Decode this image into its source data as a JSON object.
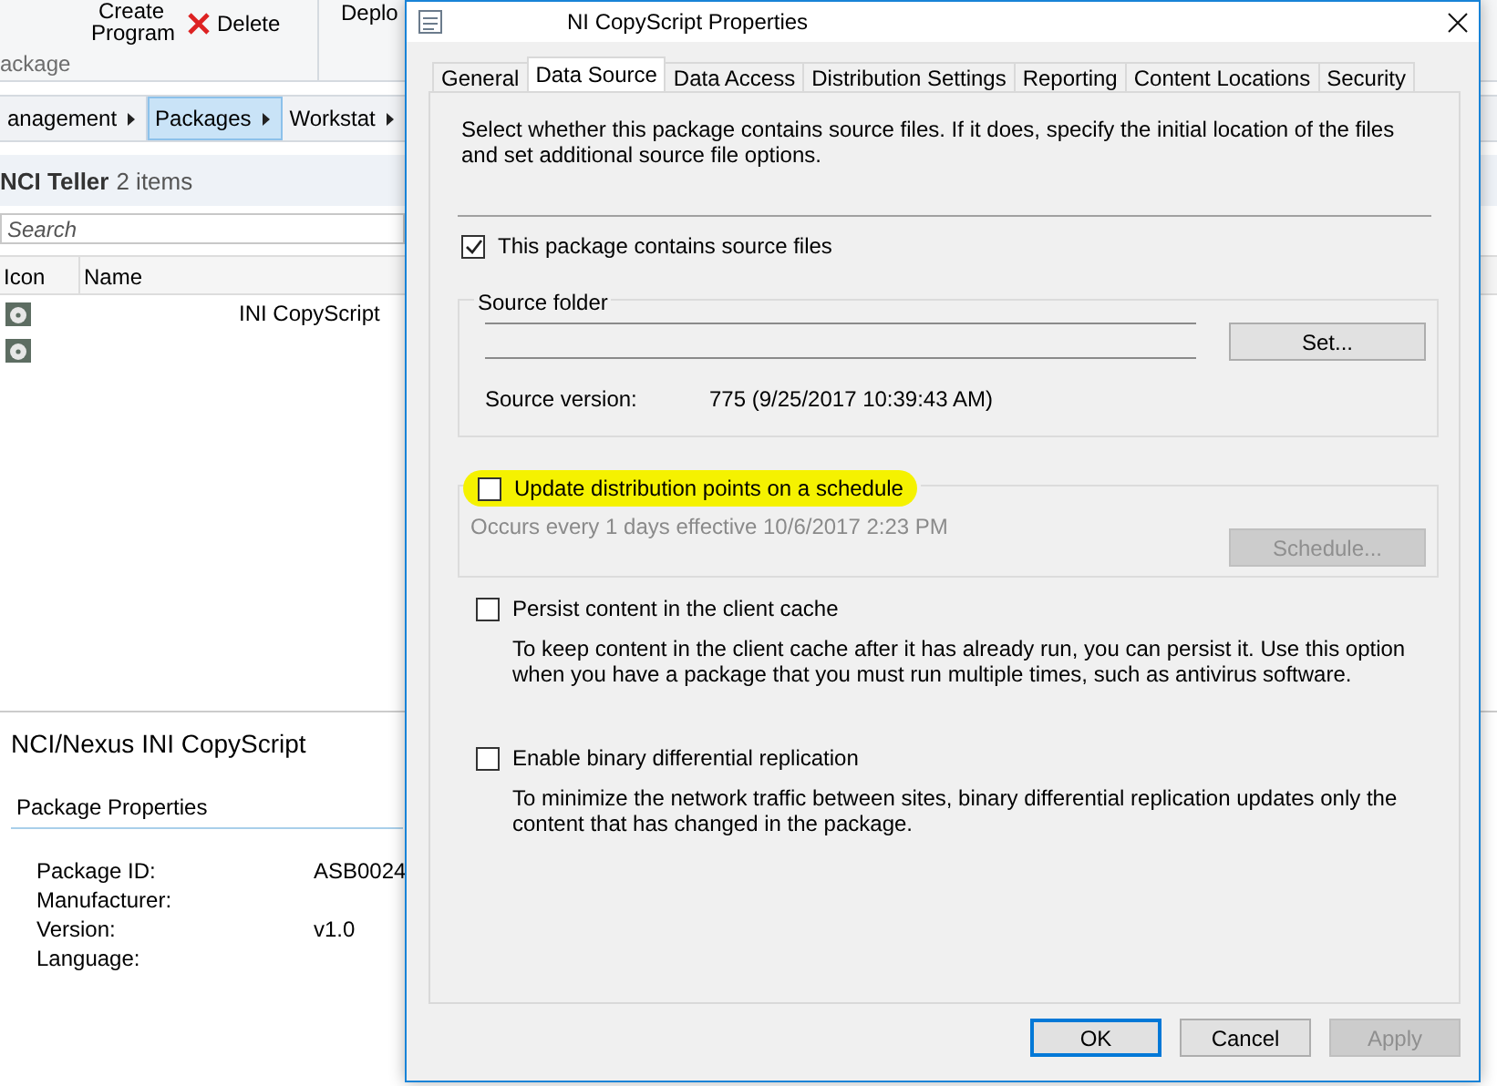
{
  "console": {
    "ribbon": {
      "buttons": [
        {
          "label": "Create Program",
          "kind": "program"
        },
        {
          "label": "Delete",
          "kind": "delete"
        }
      ],
      "group_label": "ackage",
      "next_button": "Deplo"
    },
    "breadcrumb": [
      {
        "label": "anagement",
        "selected": false
      },
      {
        "label": "Packages",
        "selected": true
      },
      {
        "label": "Workstat",
        "selected": false
      }
    ],
    "list_title": "NCI Teller",
    "list_count": "2 items",
    "search": {
      "placeholder": "Search"
    },
    "columns": [
      "Icon",
      "Name"
    ],
    "rows": [
      {
        "name": "INI CopyScript"
      },
      {
        "name": null
      }
    ],
    "details": {
      "title": "NCI/Nexus INI CopyScript",
      "section": "Package Properties",
      "properties": [
        {
          "label": "Package ID:",
          "value": "ASB0024"
        },
        {
          "label": "Manufacturer:"
        },
        {
          "label": "Version:",
          "value": "v1.0"
        },
        {
          "label": "Language:"
        }
      ]
    }
  },
  "dialog": {
    "title": "NI CopyScript Properties",
    "tabs": [
      {
        "label": "General",
        "selected": false
      },
      {
        "label": "Data Source",
        "selected": true
      },
      {
        "label": "Data Access",
        "selected": false
      },
      {
        "label": "Distribution Settings",
        "selected": false
      },
      {
        "label": "Reporting",
        "selected": false
      },
      {
        "label": "Content Locations",
        "selected": false
      },
      {
        "label": "Security",
        "selected": false
      }
    ],
    "description": "Select whether this package contains source files. If it does, specify the initial location of the files and set additional source file options.",
    "contains_source": {
      "label": "This package contains source files",
      "checked": true
    },
    "source_folder": {
      "label": "Source folder",
      "button": "Set...",
      "version_label": "Source version:",
      "version": "775 (9/25/2017 10:39:43 AM)"
    },
    "schedule": {
      "label": "Update distribution points on a schedule",
      "checked": false,
      "highlighted": true,
      "summary": "Occurs every 1 days effective 10/6/2017 2:23 PM",
      "button": "Schedule...",
      "button_disabled": true
    },
    "options": [
      {
        "label": "Persist content in the client cache",
        "checked": false,
        "description": "To keep content in the client cache after it has already run, you can persist it. Use this option when you have  a package that you must run multiple times, such as antivirus software."
      },
      {
        "label": "Enable binary differential replication",
        "checked": false,
        "description": "To minimize the network traffic between sites, binary differential replication updates only the content that has changed in the package."
      }
    ],
    "buttons": [
      {
        "label": "OK",
        "default": true,
        "disabled": false
      },
      {
        "label": "Cancel",
        "default": false,
        "disabled": false
      },
      {
        "label": "Apply",
        "default": false,
        "disabled": true
      }
    ]
  }
}
